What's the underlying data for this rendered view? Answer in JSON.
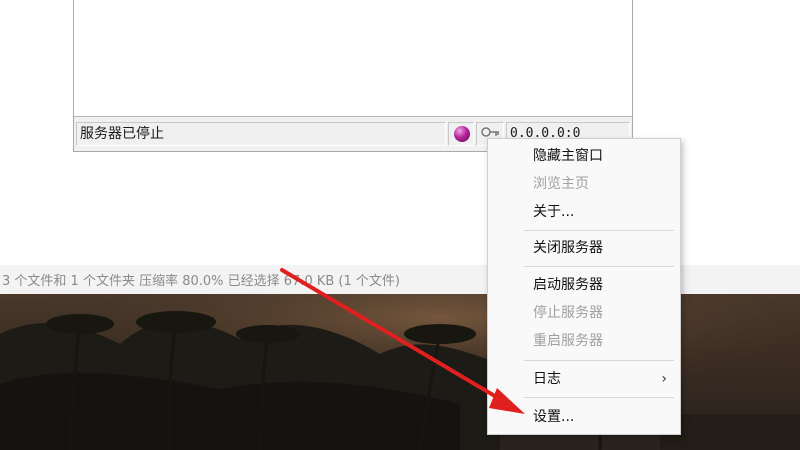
{
  "window": {
    "status_text": "服务器已停止",
    "ip_address": "0.0.0.0:0",
    "status_icon": "magenta-ball-icon",
    "key_icon": "key-icon"
  },
  "explorer": {
    "status_text": "3 个文件和 1 个文件夹 压缩率 80.0% 已经选择 67.0 KB (1 个文件)"
  },
  "context_menu": {
    "items": [
      {
        "label": "隐藏主窗口",
        "enabled": true
      },
      {
        "label": "浏览主页",
        "enabled": false
      },
      {
        "label": "关于...",
        "enabled": true
      },
      {
        "label": "关闭服务器",
        "enabled": true
      },
      {
        "label": "启动服务器",
        "enabled": true
      },
      {
        "label": "停止服务器",
        "enabled": false
      },
      {
        "label": "重启服务器",
        "enabled": false
      },
      {
        "label": "日志",
        "enabled": true,
        "submenu_glyph": "›"
      },
      {
        "label": "设置...",
        "enabled": true
      }
    ]
  },
  "annotation": {
    "arrow_color": "#e01f1f",
    "arrow_target": "设置..."
  }
}
